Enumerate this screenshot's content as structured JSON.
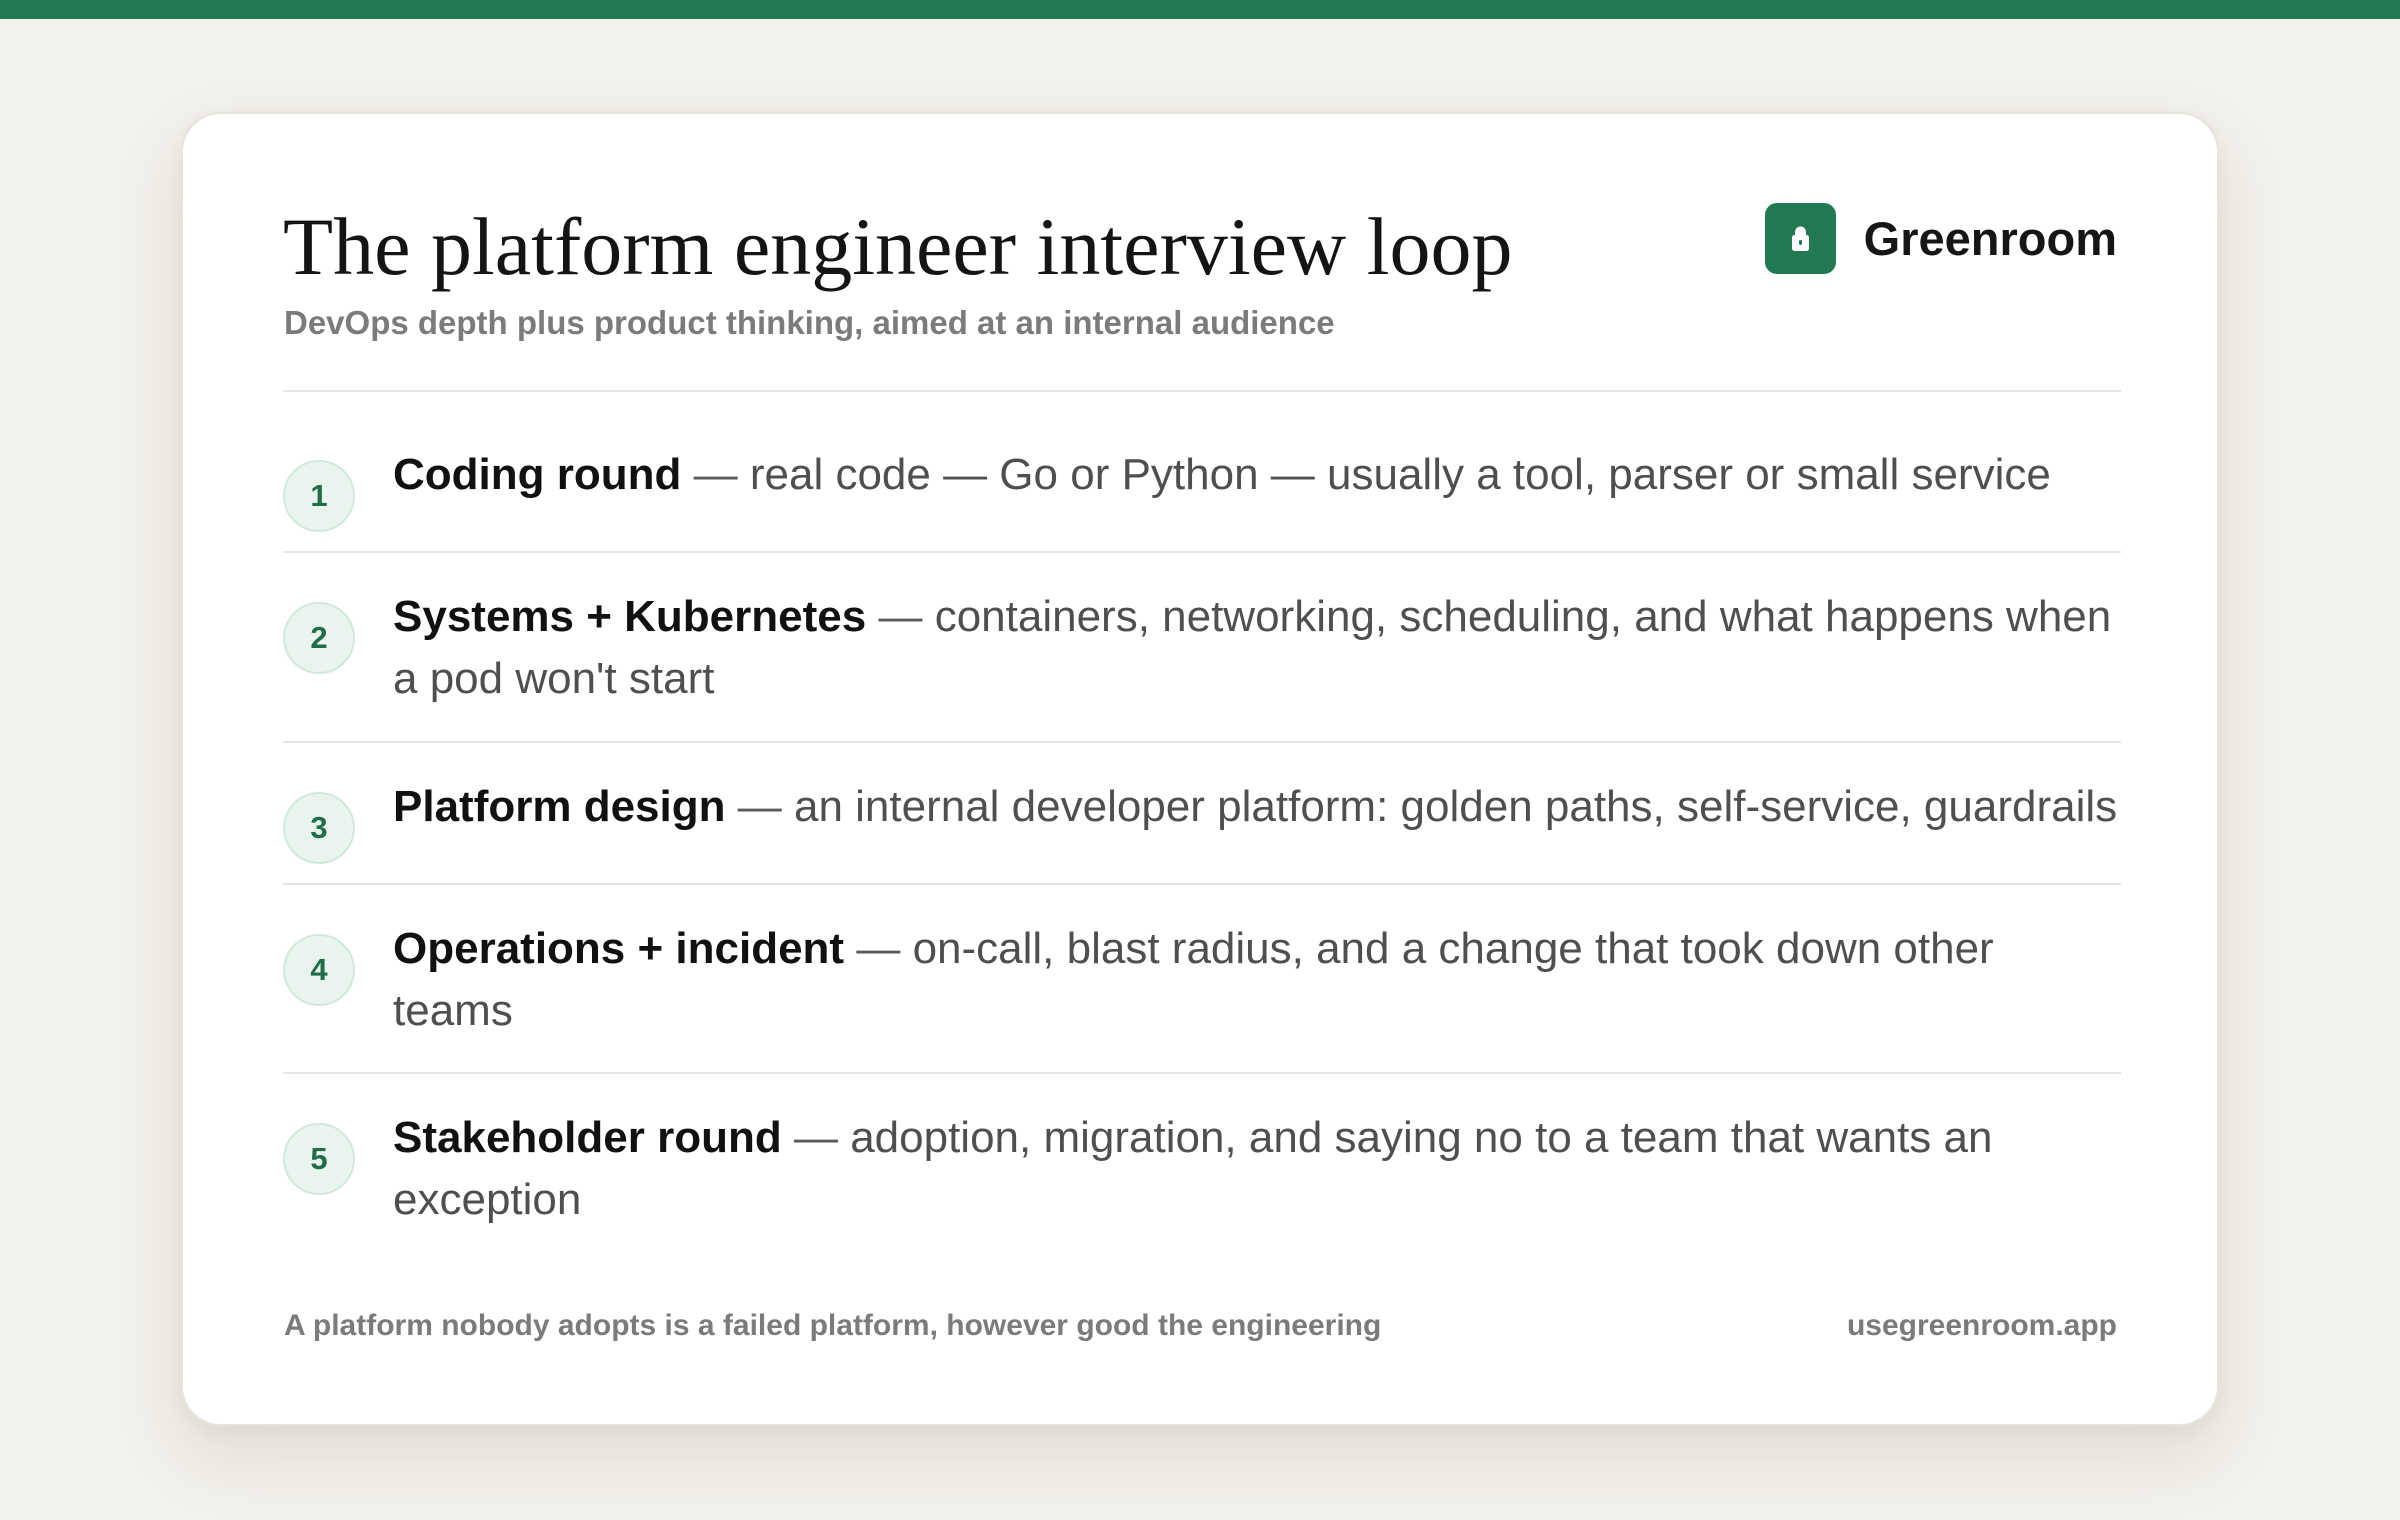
{
  "colors": {
    "accent": "#227a52",
    "background": "#f3f1eb",
    "card": "#ffffff"
  },
  "header": {
    "title": "The platform engineer interview loop",
    "subtitle": "DevOps depth plus product thinking, aimed at an internal audience"
  },
  "brand": {
    "icon": "lock-icon",
    "name": "Greenroom"
  },
  "separator": "—",
  "rounds": [
    {
      "number": "1",
      "title": "Coding round",
      "description": "real code — Go or Python — usually a tool, parser or small service"
    },
    {
      "number": "2",
      "title": "Systems + Kubernetes",
      "description": "containers, networking, scheduling, and what happens when a pod won't start"
    },
    {
      "number": "3",
      "title": "Platform design",
      "description": "an internal developer platform: golden paths, self-service, guardrails"
    },
    {
      "number": "4",
      "title": "Operations + incident",
      "description": "on-call, blast radius, and a change that took down other teams"
    },
    {
      "number": "5",
      "title": "Stakeholder round",
      "description": "adoption, migration, and saying no to a team that wants an exception"
    }
  ],
  "footer": {
    "note": "A platform nobody adopts is a failed platform, however good the engineering",
    "url": "usegreenroom.app"
  }
}
